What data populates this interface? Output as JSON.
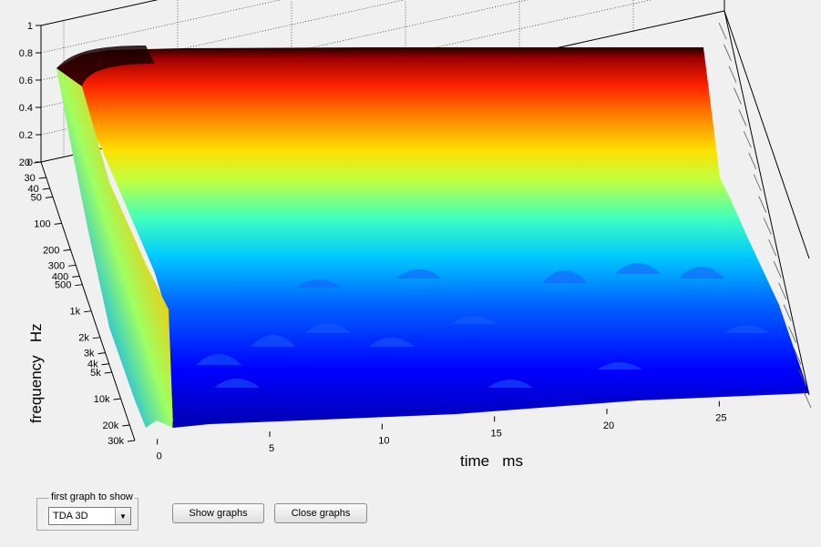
{
  "chart_data": {
    "type": "waterfall-3d",
    "title": "",
    "xlabel": "time   ms",
    "ylabel": "frequency   Hz",
    "zlabel": "",
    "x_ticks": [
      "0",
      "5",
      "10",
      "15",
      "20",
      "25"
    ],
    "x_range": [
      -1,
      29
    ],
    "y_ticks": [
      "20",
      "30",
      "40",
      "50",
      "100",
      "200",
      "300",
      "400",
      "500",
      "1k",
      "2k",
      "3k",
      "4k",
      "5k",
      "10k",
      "20k",
      "30k"
    ],
    "y_tick_values": [
      20,
      30,
      40,
      50,
      100,
      200,
      300,
      400,
      500,
      1000,
      2000,
      3000,
      4000,
      5000,
      10000,
      20000,
      30000
    ],
    "y_range": [
      20,
      30000
    ],
    "y_scale": "log",
    "z_ticks": [
      "0",
      "0.2",
      "0.4",
      "0.6",
      "0.8",
      "1"
    ],
    "z_range": [
      0,
      1
    ],
    "grid": true,
    "colormap": "jet"
  },
  "controls": {
    "group_label": "first graph to show",
    "select_value": "TDA 3D",
    "show_label": "Show graphs",
    "close_label": "Close graphs"
  }
}
